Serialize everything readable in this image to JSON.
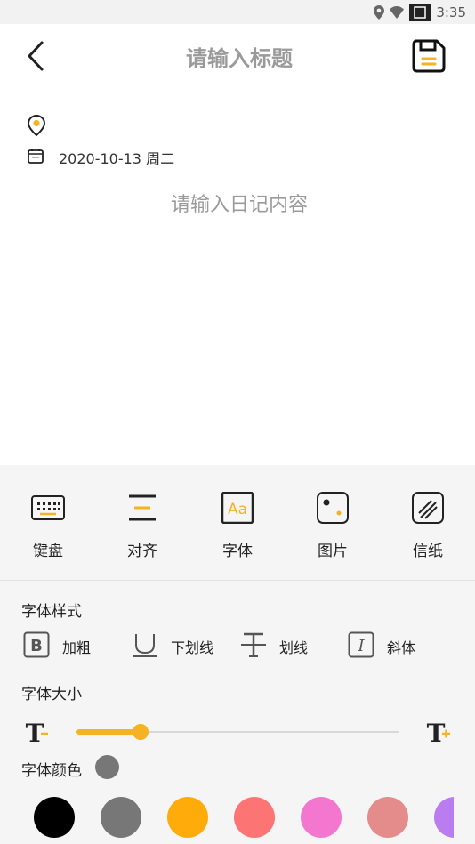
{
  "status_bar": {
    "time": "3:35"
  },
  "header": {
    "title_placeholder": "请输入标题",
    "back_icon": "chevron-left-icon",
    "save_icon": "save-icon"
  },
  "meta": {
    "location_icon": "location-pin-icon",
    "calendar_icon": "calendar-icon",
    "date": "2020-10-13 周二"
  },
  "editor": {
    "content_placeholder": "请输入日记内容"
  },
  "toolbar": {
    "items": [
      {
        "label": "键盘",
        "icon": "keyboard-icon"
      },
      {
        "label": "对齐",
        "icon": "align-icon"
      },
      {
        "label": "字体",
        "icon": "font-icon"
      },
      {
        "label": "图片",
        "icon": "image-icon"
      },
      {
        "label": "信纸",
        "icon": "letter-paper-icon"
      }
    ]
  },
  "font_panel": {
    "style_title": "字体样式",
    "styles": [
      {
        "label": "加粗",
        "icon": "bold-icon"
      },
      {
        "label": "下划线",
        "icon": "underline-icon"
      },
      {
        "label": "划线",
        "icon": "strikethrough-icon"
      },
      {
        "label": "斜体",
        "icon": "italic-icon"
      }
    ],
    "size_title": "字体大小",
    "size_level": 0.2,
    "color_title": "字体颜色",
    "current_color": "#777777",
    "accent": "#f5b324",
    "colors": [
      "#000000",
      "#777777",
      "#ffab0a",
      "#fc7474",
      "#f377ce",
      "#e48c8c",
      "#b97df0"
    ]
  }
}
